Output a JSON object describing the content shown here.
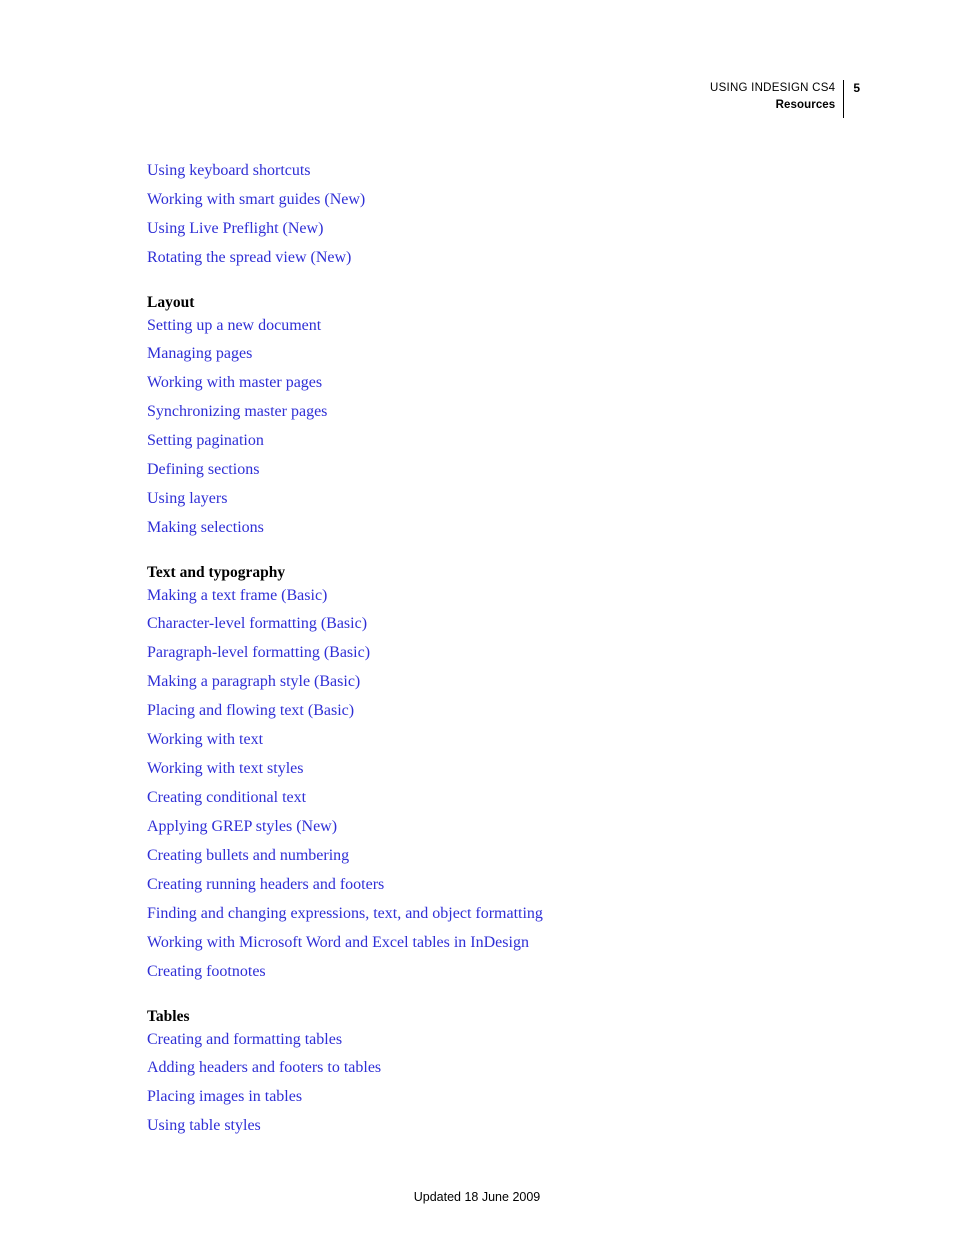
{
  "header": {
    "title": "USING INDESIGN CS4",
    "subtitle": "Resources",
    "page_number": "5",
    "rule_color": "#000000"
  },
  "link_color": "#2F2FD6",
  "body": {
    "sections": [
      {
        "heading": null,
        "links": [
          "Using keyboard shortcuts",
          "Working with smart guides (New)",
          "Using Live Preflight (New)",
          "Rotating the spread view (New)"
        ]
      },
      {
        "heading": "Layout",
        "links": [
          "Setting up a new document",
          "Managing pages",
          "Working with master pages",
          "Synchronizing master pages",
          "Setting pagination",
          "Defining sections",
          "Using layers",
          "Making selections"
        ]
      },
      {
        "heading": "Text and typography",
        "links": [
          "Making a text frame (Basic)",
          "Character-level formatting (Basic)",
          "Paragraph-level formatting (Basic)",
          "Making a paragraph style (Basic)",
          "Placing and flowing text (Basic)",
          "Working with text",
          "Working with text styles",
          "Creating conditional text",
          "Applying GREP styles (New)",
          "Creating bullets and numbering",
          "Creating running headers and footers",
          "Finding and changing expressions, text, and object formatting",
          "Working with Microsoft Word and Excel tables in InDesign",
          "Creating footnotes"
        ]
      },
      {
        "heading": "Tables",
        "links": [
          "Creating and formatting tables",
          "Adding headers and footers to tables",
          "Placing images in tables",
          "Using table styles"
        ]
      }
    ]
  },
  "footer": {
    "text": "Updated 18 June 2009"
  }
}
